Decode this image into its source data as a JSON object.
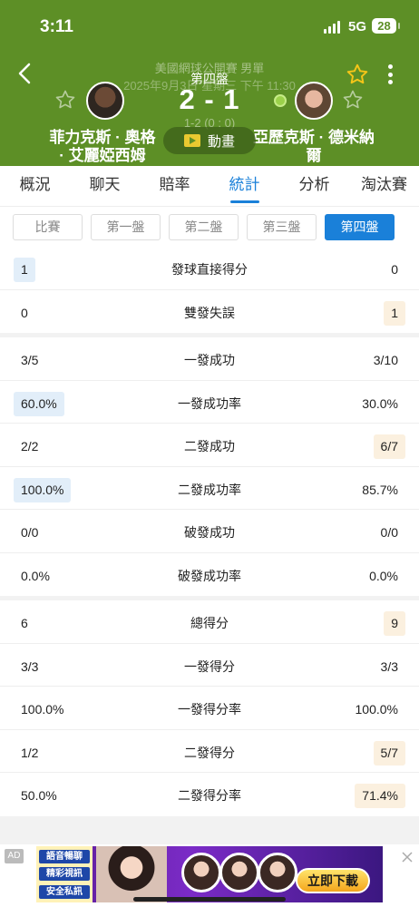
{
  "status": {
    "time": "3:11",
    "network": "5G",
    "battery": "28"
  },
  "match": {
    "tournament": "美國網球公開賽 男單",
    "datetime": "2025年9月3日 星期三 下午 11:30",
    "set_label": "第四盤",
    "score": "2 - 1",
    "set_score": "1-2 (0 : 0)",
    "animation_label": "動畫",
    "player_left": "菲力克斯 · 奧格 · 艾麗婭西姆",
    "player_right": "亞歷克斯 · 德米納爾"
  },
  "tabs": [
    {
      "label": "概況"
    },
    {
      "label": "聊天"
    },
    {
      "label": "賠率"
    },
    {
      "label": "統計"
    },
    {
      "label": "分析"
    },
    {
      "label": "淘汰賽"
    }
  ],
  "active_tab": "統計",
  "sets": [
    {
      "label": "比賽"
    },
    {
      "label": "第一盤"
    },
    {
      "label": "第二盤"
    },
    {
      "label": "第三盤"
    },
    {
      "label": "第四盤"
    }
  ],
  "active_set": "第四盤",
  "stats": {
    "group1": [
      {
        "label": "發球直接得分",
        "left": "1",
        "right": "0"
      },
      {
        "label": "雙發失誤",
        "left": "0",
        "right": "1"
      }
    ],
    "group2": [
      {
        "label": "一發成功",
        "left": "3/5",
        "right": "3/10"
      },
      {
        "label": "一發成功率",
        "left": "60.0%",
        "right": "30.0%"
      },
      {
        "label": "二發成功",
        "left": "2/2",
        "right": "6/7"
      },
      {
        "label": "二發成功率",
        "left": "100.0%",
        "right": "85.7%"
      },
      {
        "label": "破發成功",
        "left": "0/0",
        "right": "0/0"
      },
      {
        "label": "破發成功率",
        "left": "0.0%",
        "right": "0.0%"
      }
    ],
    "group3": [
      {
        "label": "總得分",
        "left": "6",
        "right": "9"
      },
      {
        "label": "一發得分",
        "left": "3/3",
        "right": "3/3"
      },
      {
        "label": "一發得分率",
        "left": "100.0%",
        "right": "100.0%"
      },
      {
        "label": "二發得分",
        "left": "1/2",
        "right": "5/7"
      },
      {
        "label": "二發得分率",
        "left": "50.0%",
        "right": "71.4%"
      }
    ]
  },
  "ad": {
    "tag": "AD",
    "lines": [
      "語音暢聊",
      "精彩視訊",
      "安全私訊"
    ],
    "cta": "立即下載"
  },
  "colors": {
    "header": "#5d8f26",
    "accent": "#1a80d9",
    "left_highlight": "#e2eef9",
    "right_highlight": "#fbf0df"
  },
  "icons": [
    "back-icon",
    "star-icon",
    "more-icon",
    "play-icon",
    "serve-icon",
    "close-icon"
  ]
}
